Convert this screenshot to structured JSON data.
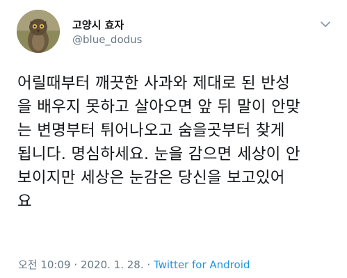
{
  "author": {
    "display_name": "고양시 효자",
    "handle": "@blue_dodus",
    "avatar_icon": "owl-bird-avatar"
  },
  "menu_icon": "chevron-down-icon",
  "tweet": {
    "text": "어릴때부터 깨끗한 사과와 제대로 된 반성\n을 배우지 못하고 살아오면 앞 뒤 말이 안맞\n는 변명부터 튀어나오고 숨을곳부터 찾게\n됩니다. 명심하세요. 눈을 감으면 세상이 안\n보이지만 세상은 눈감은 당신을 보고있어\n요"
  },
  "meta": {
    "time": "오전 10:09",
    "date": "2020. 1. 28.",
    "separator": "·",
    "source": "Twitter for Android"
  },
  "colors": {
    "text": "#14171a",
    "secondary": "#657786",
    "link": "#1b95e0"
  }
}
